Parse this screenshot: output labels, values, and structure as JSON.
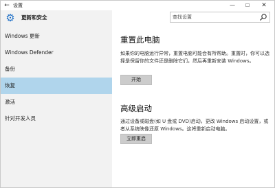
{
  "window": {
    "title": "设置",
    "back_glyph": "←",
    "min_glyph": "—",
    "max_glyph": "☐",
    "close_glyph": "✕"
  },
  "sidebar": {
    "section_title": "更新和安全",
    "items": [
      {
        "label": "Windows 更新",
        "active": false
      },
      {
        "label": "Windows Defender",
        "active": false
      },
      {
        "label": "备份",
        "active": false
      },
      {
        "label": "恢复",
        "active": true
      },
      {
        "label": "激活",
        "active": false
      },
      {
        "label": "针对开发人员",
        "active": false
      }
    ]
  },
  "search": {
    "placeholder": "查找设置"
  },
  "main": {
    "reset": {
      "title": "重置此电脑",
      "description": "如果你的电脑运行异常，重置电脑可能会有所帮助。重置时，你可以选择是保留你的文件还是删除它们，然后再重新安装 Windows。",
      "button": "开始"
    },
    "advanced": {
      "title": "高级启动",
      "description": "通过设备或磁盘(如 U 盘或 DVD)启动，更改 Windows 启动设置，或者从系统映像还原 Windows。这将重新启动电脑。",
      "button": "立即重启"
    }
  },
  "colors": {
    "accent": "#1e6fc7",
    "active_item": "#b0d5ec",
    "sidebar_bg": "#f2f2f2",
    "button_bg": "#cccccc"
  }
}
